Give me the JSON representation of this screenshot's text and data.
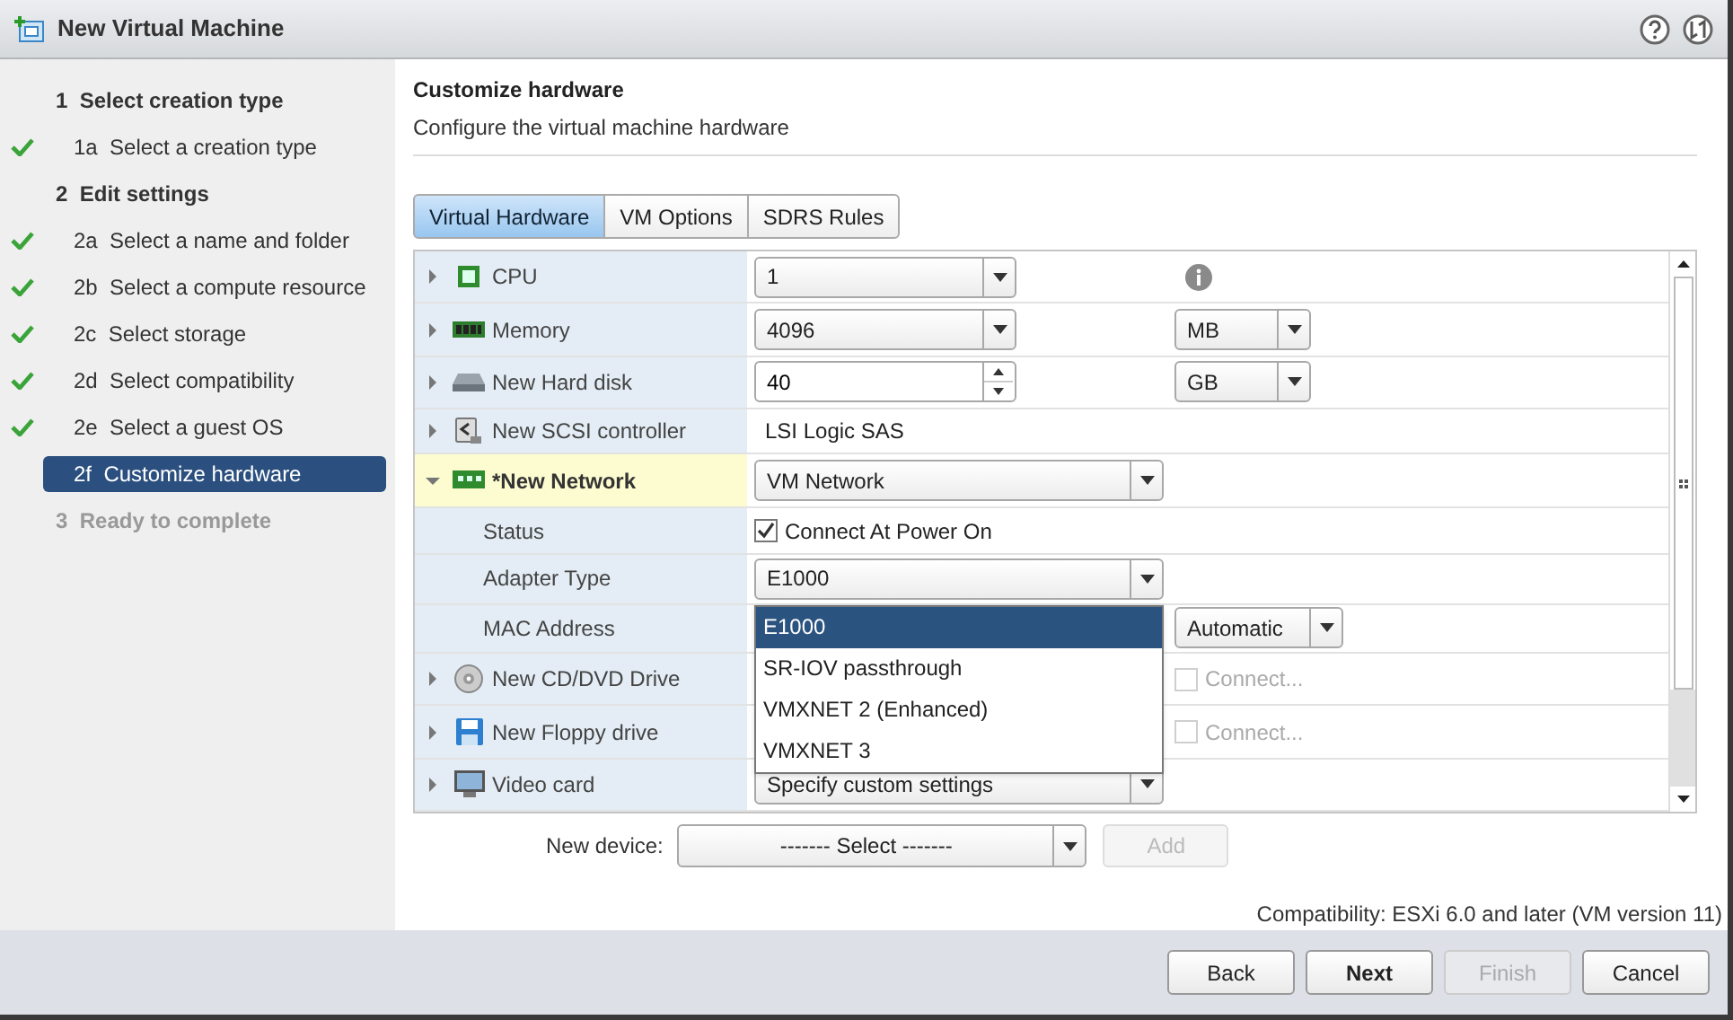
{
  "window": {
    "title": "New Virtual Machine"
  },
  "steps": [
    {
      "number": "1",
      "label": "Select creation type",
      "disabled": false,
      "children": [
        {
          "number": "1a",
          "label": "Select a creation type",
          "done": true,
          "selected": false
        }
      ]
    },
    {
      "number": "2",
      "label": "Edit settings",
      "disabled": false,
      "children": [
        {
          "number": "2a",
          "label": "Select a name and folder",
          "done": true,
          "selected": false
        },
        {
          "number": "2b",
          "label": "Select a compute resource",
          "done": true,
          "selected": false
        },
        {
          "number": "2c",
          "label": "Select storage",
          "done": true,
          "selected": false
        },
        {
          "number": "2d",
          "label": "Select compatibility",
          "done": true,
          "selected": false
        },
        {
          "number": "2e",
          "label": "Select a guest OS",
          "done": true,
          "selected": false
        },
        {
          "number": "2f",
          "label": "Customize hardware",
          "done": false,
          "selected": true
        }
      ]
    },
    {
      "number": "3",
      "label": "Ready to complete",
      "disabled": true
    }
  ],
  "page": {
    "title": "Customize hardware",
    "subtitle": "Configure the virtual machine hardware"
  },
  "tabs": [
    {
      "label": "Virtual Hardware",
      "selected": true
    },
    {
      "label": "VM Options",
      "selected": false
    },
    {
      "label": "SDRS Rules",
      "selected": false
    }
  ],
  "hardware": [
    {
      "label": "CPU",
      "expanded": false,
      "selected": false,
      "primary": {
        "kind": "combo",
        "value": "1"
      },
      "secondary": {
        "kind": "info"
      }
    },
    {
      "label": "Memory",
      "expanded": false,
      "selected": false,
      "primary": {
        "kind": "combo",
        "value": "4096"
      },
      "secondary": {
        "kind": "select",
        "value": "MB"
      }
    },
    {
      "label": "New Hard disk",
      "expanded": false,
      "selected": false,
      "primary": {
        "kind": "spinner",
        "value": "40"
      },
      "secondary": {
        "kind": "select",
        "value": "GB"
      }
    },
    {
      "label": "New SCSI controller",
      "expanded": false,
      "selected": false,
      "primary": {
        "kind": "text",
        "value": "LSI Logic SAS"
      }
    },
    {
      "label": "*New Network",
      "expanded": true,
      "selected": true,
      "primary": {
        "kind": "select",
        "value": "VM Network"
      },
      "children": [
        {
          "label": "Status",
          "primary": {
            "kind": "checkbox",
            "checked": true,
            "disabled": false,
            "text": "Connect At Power On"
          }
        },
        {
          "label": "Adapter Type",
          "primary": {
            "kind": "select",
            "value": "E1000",
            "open": true,
            "options": [
              {
                "label": "E1000",
                "selected": true
              },
              {
                "label": "SR-IOV passthrough",
                "selected": false
              },
              {
                "label": "VMXNET 2 (Enhanced)",
                "selected": false
              },
              {
                "label": "VMXNET 3",
                "selected": false
              }
            ]
          }
        },
        {
          "label": "MAC Address",
          "secondary": {
            "kind": "select",
            "value": "Automatic"
          }
        }
      ]
    },
    {
      "label": "New CD/DVD Drive",
      "expanded": false,
      "selected": false,
      "secondary": {
        "kind": "checkbox",
        "checked": false,
        "disabled": true,
        "text": "Connect..."
      }
    },
    {
      "label": "New Floppy drive",
      "expanded": false,
      "selected": false,
      "secondary": {
        "kind": "checkbox",
        "checked": false,
        "disabled": true,
        "text": "Connect..."
      }
    },
    {
      "label": "Video card",
      "expanded": false,
      "selected": false,
      "primary": {
        "kind": "select",
        "value": "Specify custom settings"
      }
    }
  ],
  "new_device": {
    "label": "New device:",
    "value": "------- Select -------",
    "add": {
      "label": "Add",
      "disabled": true
    }
  },
  "compatibility": "Compatibility: ESXi 6.0 and later (VM version 11)",
  "buttons": [
    {
      "label": "Back",
      "disabled": false,
      "primary": false
    },
    {
      "label": "Next",
      "disabled": false,
      "primary": true
    },
    {
      "label": "Finish",
      "disabled": true,
      "primary": false
    },
    {
      "label": "Cancel",
      "disabled": false,
      "primary": false
    }
  ]
}
